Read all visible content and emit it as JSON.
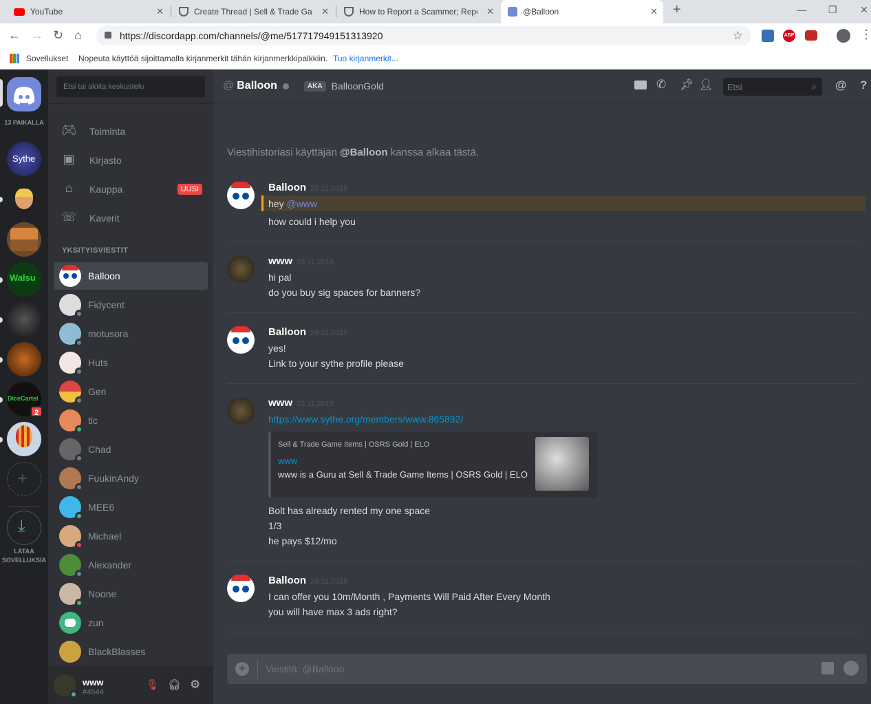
{
  "browser": {
    "tabs": [
      {
        "title": "YouTube"
      },
      {
        "title": "Create Thread | Sell & Trade Gam"
      },
      {
        "title": "How to Report a Scammer; Repo"
      },
      {
        "title": "@Balloon"
      }
    ],
    "url": "https://discordapp.com/channels/@me/517717949151313920",
    "bookmarks_apps": "Sovellukset",
    "bookmarks_hint": "Nopeuta käyttöä sijoittamalla kirjanmerkit tähän kirjanmerkkipalkkiin.",
    "bookmarks_import": "Tuo kirjanmerkit..."
  },
  "guilds": {
    "online_count": "13 PAIKALLA",
    "dicecartel_badge": "2",
    "download_label_1": "LATAA",
    "download_label_2": "SOVELLUKSIA"
  },
  "sidebar": {
    "search_placeholder": "Etsi tai aloita keskustelu",
    "nav": [
      {
        "label": "Toiminta"
      },
      {
        "label": "Kirjasto"
      },
      {
        "label": "Kauppa",
        "badge": "UUSI"
      },
      {
        "label": "Kaverit"
      }
    ],
    "dm_header": "YKSITYISVIESTIT",
    "dms": [
      {
        "name": "Balloon"
      },
      {
        "name": "Fidycent"
      },
      {
        "name": "motusora"
      },
      {
        "name": "Huts"
      },
      {
        "name": "Gen"
      },
      {
        "name": "tic"
      },
      {
        "name": "Chad"
      },
      {
        "name": "FuukinAndy"
      },
      {
        "name": "MEE6"
      },
      {
        "name": "Michael"
      },
      {
        "name": "Alexander"
      },
      {
        "name": "Noone"
      },
      {
        "name": "zun"
      },
      {
        "name": "BlackBlasses"
      }
    ],
    "user": {
      "name": "www",
      "tag": "#4544"
    }
  },
  "chat": {
    "header_name": "Balloon",
    "aka": "AKA",
    "aka_name": "BalloonGold",
    "search_placeholder": "Etsi",
    "history_pre": "Viestihistoriasi käyttäjän ",
    "history_user": "@Balloon",
    "history_post": " kanssa alkaa tästä.",
    "messages": [
      {
        "author": "Balloon",
        "time": "29.11.2018",
        "lines": [
          "hey",
          "@www",
          "how could i help you"
        ]
      },
      {
        "author": "www",
        "time": "29.11.2018",
        "lines": [
          "hi pal",
          "do you buy sig spaces for banners?"
        ]
      },
      {
        "author": "Balloon",
        "time": "29.11.2018",
        "lines": [
          "yes!",
          "Link to your sythe profile please"
        ]
      },
      {
        "author": "www",
        "time": "29.11.2018",
        "lines": [
          "https://www.sythe.org/members/www.865892/",
          "Bolt has already rented my one space",
          "1/3",
          "he pays $12/mo"
        ]
      },
      {
        "author": "Balloon",
        "time": "29.11.2018",
        "lines": [
          "I can offer you 10m/Month , Payments Will Paid After Every Month",
          "you will have max 3 ads right?"
        ]
      }
    ],
    "embed": {
      "provider": "Sell & Trade Game Items | OSRS Gold | ELO",
      "title": "www",
      "desc": "www is a Guru at Sell & Trade Game Items | OSRS Gold | ELO"
    },
    "composer_placeholder": "Viestitä: @Balloon"
  }
}
